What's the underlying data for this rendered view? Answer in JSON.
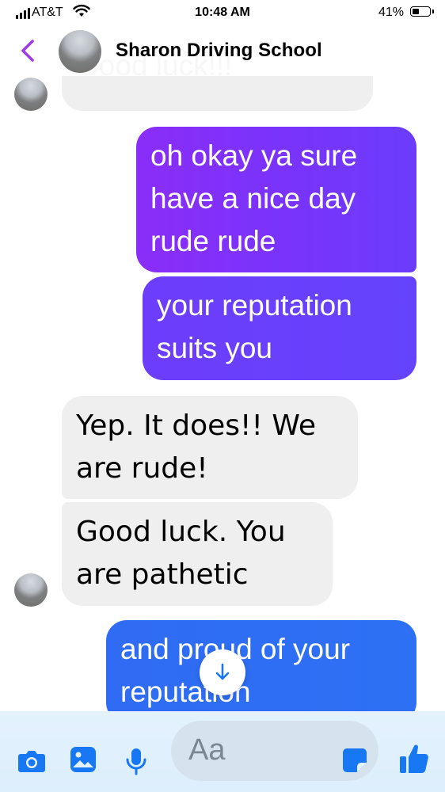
{
  "status_bar": {
    "carrier": "AT&T",
    "time": "10:48 AM",
    "battery_percent": "41%",
    "battery_level": 0.41
  },
  "header": {
    "contact_name": "Sharon Driving School",
    "back_icon": "chevron-left-icon"
  },
  "messages": [
    {
      "direction": "incoming",
      "text": "Good luck!!!"
    },
    {
      "direction": "outgoing",
      "text": "oh okay ya sure have a nice day rude rude"
    },
    {
      "direction": "outgoing",
      "text": "your reputation suits you"
    },
    {
      "direction": "incoming",
      "text": "Yep. It does!! We are rude!"
    },
    {
      "direction": "incoming",
      "text": "Good luck. You are pathetic"
    },
    {
      "direction": "outgoing",
      "text": "and proud of your reputation"
    }
  ],
  "composer": {
    "placeholder": "Aa",
    "icons": [
      "camera-icon",
      "photo-icon",
      "microphone-icon",
      "sticker-icon",
      "thumbs-up-icon"
    ]
  },
  "colors": {
    "accent_purple": "#8a2df8",
    "accent_violet": "#6b3cfc",
    "accent_blue": "#2f6cf3",
    "incoming_bubble": "#efefef",
    "composer_icon": "#1877f2"
  }
}
